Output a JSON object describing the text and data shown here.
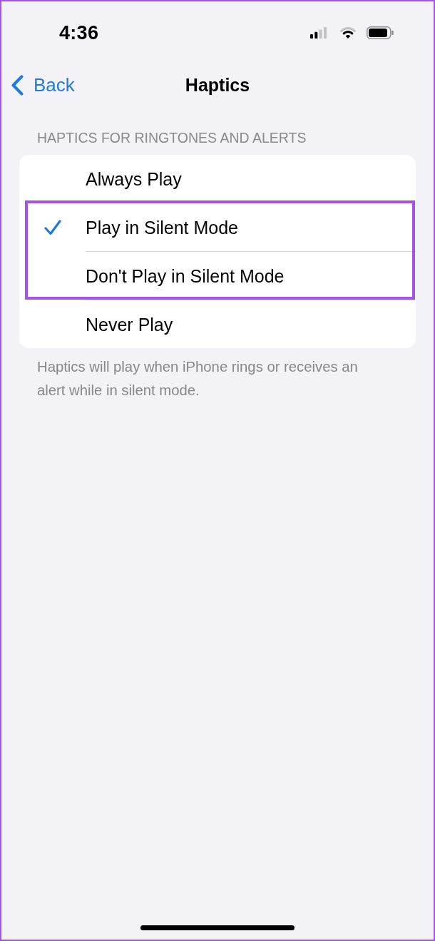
{
  "status_bar": {
    "time": "4:36"
  },
  "nav": {
    "back": "Back",
    "title": "Haptics"
  },
  "section": {
    "header": "HAPTICS FOR RINGTONES AND ALERTS",
    "options": [
      {
        "label": "Always Play",
        "selected": false,
        "highlighted": false
      },
      {
        "label": "Play in Silent Mode",
        "selected": true,
        "highlighted": true
      },
      {
        "label": "Don't Play in Silent Mode",
        "selected": false,
        "highlighted": true
      },
      {
        "label": "Never Play",
        "selected": false,
        "highlighted": false
      }
    ],
    "footer": "Haptics will play when iPhone rings or receives an alert while in silent mode."
  }
}
